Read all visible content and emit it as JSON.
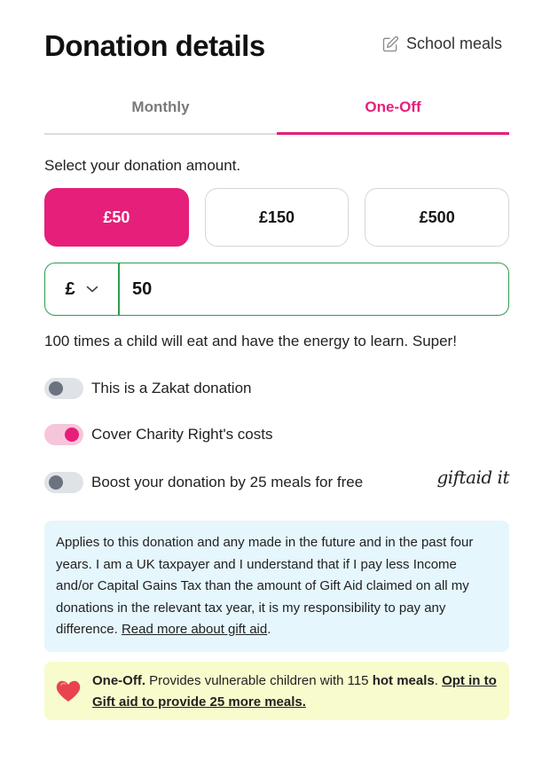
{
  "header": {
    "title": "Donation details",
    "school_meals_label": "School meals"
  },
  "tabs": [
    {
      "label": "Monthly",
      "active": false
    },
    {
      "label": "One-Off",
      "active": true
    }
  ],
  "amount_section": {
    "label": "Select your donation amount.",
    "options": [
      "£50",
      "£150",
      "£500"
    ],
    "selected": "£50",
    "currency": "£",
    "value": "50"
  },
  "impact_text": "100 times a child will eat and have the energy to learn. Super!",
  "toggles": {
    "zakat": {
      "label": "This is a Zakat donation",
      "on": false
    },
    "cover_costs": {
      "label": "Cover Charity Right's costs",
      "on": true
    },
    "boost": {
      "label": "Boost your donation by 25 meals for free",
      "on": false
    }
  },
  "gift_aid_logo": "giftaid it",
  "gift_aid_info": {
    "text": "Applies to this donation and any made in the future and in the past four years. I am a UK taxpayer and I understand that if I pay less Income and/or Capital Gains Tax than the amount of Gift Aid claimed on all my donations in the relevant tax year, it is my responsibility to pay any difference.",
    "link": "Read more about gift aid",
    "end": "."
  },
  "promo": {
    "prefix": "One-Off.",
    "text": " Provides vulnerable children with 115 ",
    "highlight": "hot meals",
    "after": ". ",
    "link": "Opt in to Gift aid to provide 25 more meals."
  },
  "colors": {
    "accent": "#e51f7a",
    "input_border": "#2e9e4e",
    "info_bg": "#e5f6fd",
    "promo_bg": "#f8fbcc"
  }
}
